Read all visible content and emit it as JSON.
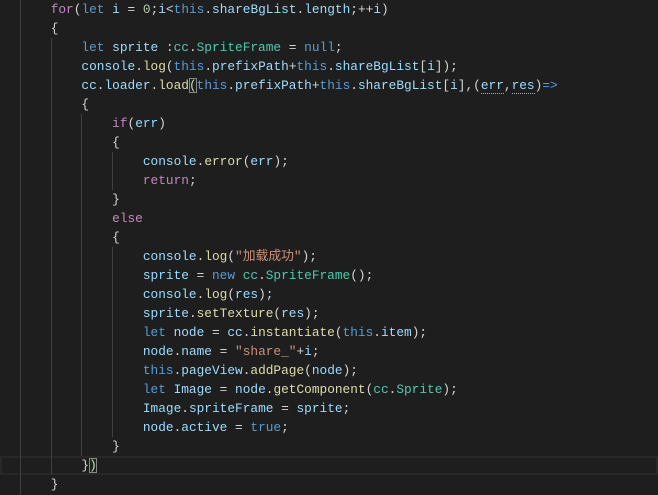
{
  "editor": {
    "theme": {
      "background": "#1e1e1e",
      "control": "#c586c0",
      "keyword": "#569cd6",
      "variable": "#9cdcfe",
      "function": "#dcdcaa",
      "type": "#4ec9b0",
      "number": "#b5cea8",
      "string": "#ce9178",
      "punct": "#d4d4d4",
      "indent_guide": "#404040",
      "bracket_match": "#888888",
      "line_highlight": "#282828"
    },
    "lines": [
      {
        "leading_spaces": 4,
        "tokens": [
          {
            "t": "for",
            "c": "control"
          },
          {
            "t": "(",
            "c": "punct"
          },
          {
            "t": "let ",
            "c": "keyword"
          },
          {
            "t": "i",
            "c": "variable"
          },
          {
            "t": " = ",
            "c": "punct"
          },
          {
            "t": "0",
            "c": "number"
          },
          {
            "t": ";",
            "c": "punct"
          },
          {
            "t": "i",
            "c": "variable"
          },
          {
            "t": "<",
            "c": "punct"
          },
          {
            "t": "this",
            "c": "keyword"
          },
          {
            "t": ".",
            "c": "punct"
          },
          {
            "t": "shareBgList",
            "c": "variable"
          },
          {
            "t": ".",
            "c": "punct"
          },
          {
            "t": "length",
            "c": "variable"
          },
          {
            "t": ";++",
            "c": "punct"
          },
          {
            "t": "i",
            "c": "variable"
          },
          {
            "t": ")",
            "c": "punct"
          }
        ]
      },
      {
        "leading_spaces": 4,
        "tokens": [
          {
            "t": "{",
            "c": "punct"
          }
        ]
      },
      {
        "leading_spaces": 8,
        "tokens": [
          {
            "t": "let ",
            "c": "keyword"
          },
          {
            "t": "sprite",
            "c": "variable"
          },
          {
            "t": " :",
            "c": "punct"
          },
          {
            "t": "cc",
            "c": "type"
          },
          {
            "t": ".",
            "c": "punct"
          },
          {
            "t": "SpriteFrame",
            "c": "type"
          },
          {
            "t": " = ",
            "c": "punct"
          },
          {
            "t": "null",
            "c": "keyword"
          },
          {
            "t": ";",
            "c": "punct"
          }
        ]
      },
      {
        "leading_spaces": 8,
        "tokens": [
          {
            "t": "console",
            "c": "variable"
          },
          {
            "t": ".",
            "c": "punct"
          },
          {
            "t": "log",
            "c": "function"
          },
          {
            "t": "(",
            "c": "punct"
          },
          {
            "t": "this",
            "c": "keyword"
          },
          {
            "t": ".",
            "c": "punct"
          },
          {
            "t": "prefixPath",
            "c": "variable"
          },
          {
            "t": "+",
            "c": "punct"
          },
          {
            "t": "this",
            "c": "keyword"
          },
          {
            "t": ".",
            "c": "punct"
          },
          {
            "t": "shareBgList",
            "c": "variable"
          },
          {
            "t": "[",
            "c": "punct"
          },
          {
            "t": "i",
            "c": "variable"
          },
          {
            "t": "]);",
            "c": "punct"
          }
        ]
      },
      {
        "leading_spaces": 8,
        "tokens": [
          {
            "t": "cc",
            "c": "variable"
          },
          {
            "t": ".",
            "c": "punct"
          },
          {
            "t": "loader",
            "c": "variable"
          },
          {
            "t": ".",
            "c": "punct"
          },
          {
            "t": "load",
            "c": "function"
          },
          {
            "t": "(",
            "c": "punct",
            "match": true
          },
          {
            "t": "this",
            "c": "keyword"
          },
          {
            "t": ".",
            "c": "punct"
          },
          {
            "t": "prefixPath",
            "c": "variable"
          },
          {
            "t": "+",
            "c": "punct"
          },
          {
            "t": "this",
            "c": "keyword"
          },
          {
            "t": ".",
            "c": "punct"
          },
          {
            "t": "shareBgList",
            "c": "variable"
          },
          {
            "t": "[",
            "c": "punct"
          },
          {
            "t": "i",
            "c": "variable"
          },
          {
            "t": "],(",
            "c": "punct"
          },
          {
            "t": "err",
            "c": "variable",
            "hint": true
          },
          {
            "t": ",",
            "c": "punct"
          },
          {
            "t": "res",
            "c": "variable",
            "hint": true
          },
          {
            "t": ")",
            "c": "punct"
          },
          {
            "t": "=>",
            "c": "keyword"
          }
        ]
      },
      {
        "leading_spaces": 8,
        "tokens": [
          {
            "t": "{",
            "c": "punct"
          }
        ]
      },
      {
        "leading_spaces": 12,
        "tokens": [
          {
            "t": "if",
            "c": "control"
          },
          {
            "t": "(",
            "c": "punct"
          },
          {
            "t": "err",
            "c": "variable"
          },
          {
            "t": ")",
            "c": "punct"
          }
        ]
      },
      {
        "leading_spaces": 12,
        "tokens": [
          {
            "t": "{",
            "c": "punct"
          }
        ]
      },
      {
        "leading_spaces": 16,
        "tokens": [
          {
            "t": "console",
            "c": "variable"
          },
          {
            "t": ".",
            "c": "punct"
          },
          {
            "t": "error",
            "c": "function"
          },
          {
            "t": "(",
            "c": "punct"
          },
          {
            "t": "err",
            "c": "variable"
          },
          {
            "t": ");",
            "c": "punct"
          }
        ]
      },
      {
        "leading_spaces": 16,
        "tokens": [
          {
            "t": "return",
            "c": "control"
          },
          {
            "t": ";",
            "c": "punct"
          }
        ]
      },
      {
        "leading_spaces": 12,
        "tokens": [
          {
            "t": "}",
            "c": "punct"
          }
        ]
      },
      {
        "leading_spaces": 12,
        "tokens": [
          {
            "t": "else",
            "c": "control"
          }
        ]
      },
      {
        "leading_spaces": 12,
        "tokens": [
          {
            "t": "{",
            "c": "punct"
          }
        ]
      },
      {
        "leading_spaces": 16,
        "tokens": [
          {
            "t": "console",
            "c": "variable"
          },
          {
            "t": ".",
            "c": "punct"
          },
          {
            "t": "log",
            "c": "function"
          },
          {
            "t": "(",
            "c": "punct"
          },
          {
            "t": "\"加载成功\"",
            "c": "string"
          },
          {
            "t": ");",
            "c": "punct"
          }
        ]
      },
      {
        "leading_spaces": 16,
        "tokens": [
          {
            "t": "sprite",
            "c": "variable"
          },
          {
            "t": " = ",
            "c": "punct"
          },
          {
            "t": "new ",
            "c": "keyword"
          },
          {
            "t": "cc",
            "c": "type"
          },
          {
            "t": ".",
            "c": "punct"
          },
          {
            "t": "SpriteFrame",
            "c": "type"
          },
          {
            "t": "();",
            "c": "punct"
          }
        ]
      },
      {
        "leading_spaces": 16,
        "tokens": [
          {
            "t": "console",
            "c": "variable"
          },
          {
            "t": ".",
            "c": "punct"
          },
          {
            "t": "log",
            "c": "function"
          },
          {
            "t": "(",
            "c": "punct"
          },
          {
            "t": "res",
            "c": "variable"
          },
          {
            "t": ");",
            "c": "punct"
          }
        ]
      },
      {
        "leading_spaces": 16,
        "tokens": [
          {
            "t": "sprite",
            "c": "variable"
          },
          {
            "t": ".",
            "c": "punct"
          },
          {
            "t": "setTexture",
            "c": "function"
          },
          {
            "t": "(",
            "c": "punct"
          },
          {
            "t": "res",
            "c": "variable"
          },
          {
            "t": ");",
            "c": "punct"
          }
        ]
      },
      {
        "leading_spaces": 16,
        "tokens": [
          {
            "t": "let ",
            "c": "keyword"
          },
          {
            "t": "node",
            "c": "variable"
          },
          {
            "t": " = ",
            "c": "punct"
          },
          {
            "t": "cc",
            "c": "variable"
          },
          {
            "t": ".",
            "c": "punct"
          },
          {
            "t": "instantiate",
            "c": "function"
          },
          {
            "t": "(",
            "c": "punct"
          },
          {
            "t": "this",
            "c": "keyword"
          },
          {
            "t": ".",
            "c": "punct"
          },
          {
            "t": "item",
            "c": "variable"
          },
          {
            "t": ");",
            "c": "punct"
          }
        ]
      },
      {
        "leading_spaces": 16,
        "tokens": [
          {
            "t": "node",
            "c": "variable"
          },
          {
            "t": ".",
            "c": "punct"
          },
          {
            "t": "name",
            "c": "variable"
          },
          {
            "t": " = ",
            "c": "punct"
          },
          {
            "t": "\"share_\"",
            "c": "string"
          },
          {
            "t": "+",
            "c": "punct"
          },
          {
            "t": "i",
            "c": "variable"
          },
          {
            "t": ";",
            "c": "punct"
          }
        ]
      },
      {
        "leading_spaces": 16,
        "tokens": [
          {
            "t": "this",
            "c": "keyword"
          },
          {
            "t": ".",
            "c": "punct"
          },
          {
            "t": "pageView",
            "c": "variable"
          },
          {
            "t": ".",
            "c": "punct"
          },
          {
            "t": "addPage",
            "c": "function"
          },
          {
            "t": "(",
            "c": "punct"
          },
          {
            "t": "node",
            "c": "variable"
          },
          {
            "t": ");",
            "c": "punct"
          }
        ]
      },
      {
        "leading_spaces": 16,
        "tokens": [
          {
            "t": "let ",
            "c": "keyword"
          },
          {
            "t": "Image",
            "c": "variable"
          },
          {
            "t": " = ",
            "c": "punct"
          },
          {
            "t": "node",
            "c": "variable"
          },
          {
            "t": ".",
            "c": "punct"
          },
          {
            "t": "getComponent",
            "c": "function"
          },
          {
            "t": "(",
            "c": "punct"
          },
          {
            "t": "cc",
            "c": "type"
          },
          {
            "t": ".",
            "c": "punct"
          },
          {
            "t": "Sprite",
            "c": "type"
          },
          {
            "t": ");",
            "c": "punct"
          }
        ]
      },
      {
        "leading_spaces": 16,
        "tokens": [
          {
            "t": "Image",
            "c": "variable"
          },
          {
            "t": ".",
            "c": "punct"
          },
          {
            "t": "spriteFrame",
            "c": "variable"
          },
          {
            "t": " = ",
            "c": "punct"
          },
          {
            "t": "sprite",
            "c": "variable"
          },
          {
            "t": ";",
            "c": "punct"
          }
        ]
      },
      {
        "leading_spaces": 16,
        "tokens": [
          {
            "t": "node",
            "c": "variable"
          },
          {
            "t": ".",
            "c": "punct"
          },
          {
            "t": "active",
            "c": "variable"
          },
          {
            "t": " = ",
            "c": "punct"
          },
          {
            "t": "true",
            "c": "keyword"
          },
          {
            "t": ";",
            "c": "punct"
          }
        ]
      },
      {
        "leading_spaces": 12,
        "tokens": [
          {
            "t": "}",
            "c": "punct"
          }
        ]
      },
      {
        "leading_spaces": 8,
        "current": true,
        "tokens": [
          {
            "t": "}",
            "c": "punct"
          },
          {
            "t": ")",
            "c": "punct",
            "match": true
          }
        ]
      },
      {
        "leading_spaces": 4,
        "tokens": [
          {
            "t": "}",
            "c": "punct"
          }
        ]
      }
    ]
  }
}
